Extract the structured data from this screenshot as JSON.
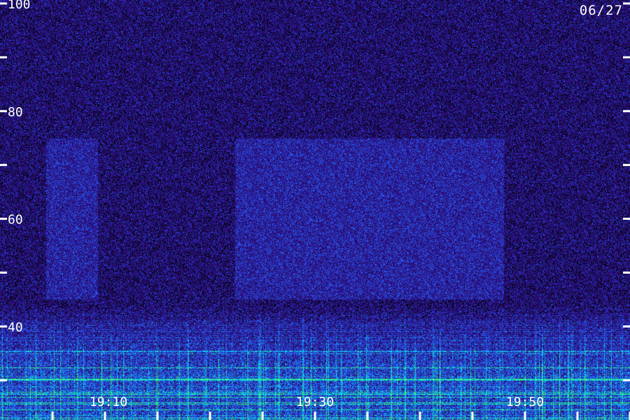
{
  "chart_data": {
    "type": "heatmap",
    "title": "",
    "xlabel": "",
    "ylabel": "",
    "date_label": "06/27",
    "y_ticks": [
      {
        "value": 100,
        "label": "100"
      },
      {
        "value": 90,
        "label": ""
      },
      {
        "value": 80,
        "label": "80"
      },
      {
        "value": 70,
        "label": ""
      },
      {
        "value": 60,
        "label": "60"
      },
      {
        "value": 50,
        "label": ""
      },
      {
        "value": 40,
        "label": "40"
      },
      {
        "value": 30,
        "label": ""
      }
    ],
    "ylim": [
      26,
      100
    ],
    "x_labels": [
      "19:10",
      "19:30",
      "19:50"
    ],
    "x_minor_tick_count": 12,
    "grid": false,
    "colormap": [
      "#000000",
      "#1a0a55",
      "#2a14b4",
      "#2e5cff",
      "#00c8ff",
      "#39ff6a"
    ],
    "description_of_energy": "Intense broadband noise concentrated below about 40 on the vertical scale; faint elevated background between about 45 and 75."
  }
}
